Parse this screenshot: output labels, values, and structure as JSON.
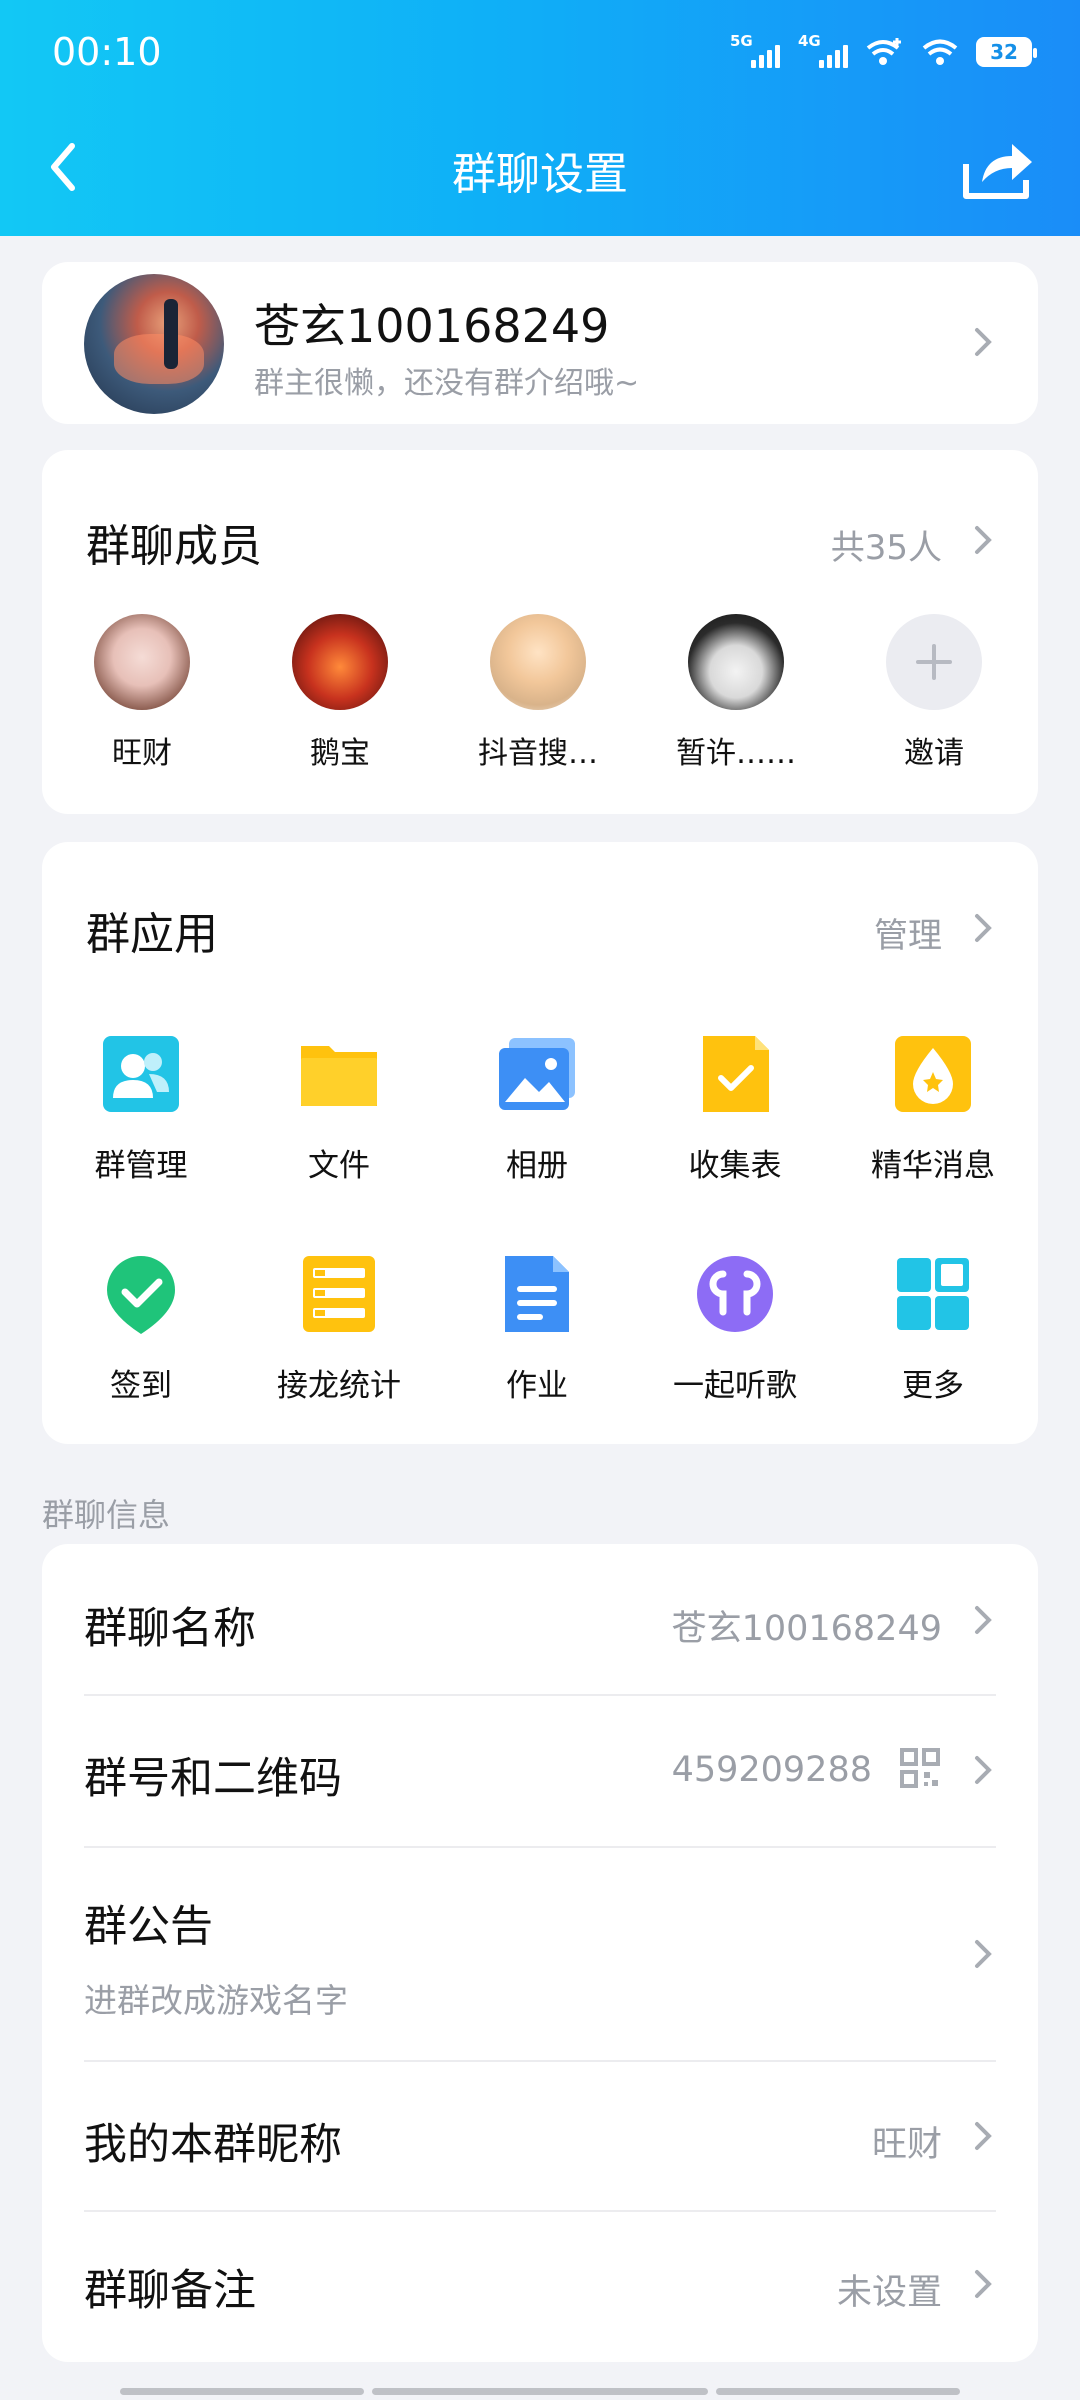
{
  "status_bar": {
    "time": "00:10",
    "network1": "5G",
    "network2": "4G",
    "battery": "32"
  },
  "header": {
    "title": "群聊设置"
  },
  "group": {
    "name": "苍玄100168249",
    "description": "群主很懒，还没有群介绍哦~"
  },
  "members": {
    "title": "群聊成员",
    "count": "共35人",
    "items": [
      {
        "name": "旺财"
      },
      {
        "name": "鹅宝"
      },
      {
        "name": "抖音搜…"
      },
      {
        "name": "暂许……"
      },
      {
        "name": "邀请"
      }
    ]
  },
  "apps": {
    "title": "群应用",
    "manage": "管理",
    "items": [
      {
        "label": "群管理",
        "icon": "group-manage-icon"
      },
      {
        "label": "文件",
        "icon": "folder-icon"
      },
      {
        "label": "相册",
        "icon": "album-icon"
      },
      {
        "label": "收集表",
        "icon": "form-icon"
      },
      {
        "label": "精华消息",
        "icon": "essence-icon"
      },
      {
        "label": "签到",
        "icon": "checkin-icon"
      },
      {
        "label": "接龙统计",
        "icon": "relay-icon"
      },
      {
        "label": "作业",
        "icon": "homework-icon"
      },
      {
        "label": "一起听歌",
        "icon": "music-icon"
      },
      {
        "label": "更多",
        "icon": "more-grid-icon"
      }
    ]
  },
  "info": {
    "section_label": "群聊信息",
    "group_name_label": "群聊名称",
    "group_name_value": "苍玄100168249",
    "group_id_label": "群号和二维码",
    "group_id_value": "459209288",
    "notice_label": "群公告",
    "notice_value": "进群改成游戏名字",
    "nickname_label": "我的本群昵称",
    "nickname_value": "旺财",
    "remark_label": "群聊备注",
    "remark_value": "未设置"
  },
  "colors": {
    "header_start": "#12c8f5",
    "header_end": "#1a8df8",
    "secondary_text": "#9a9ea6",
    "background": "#f2f3f7"
  }
}
